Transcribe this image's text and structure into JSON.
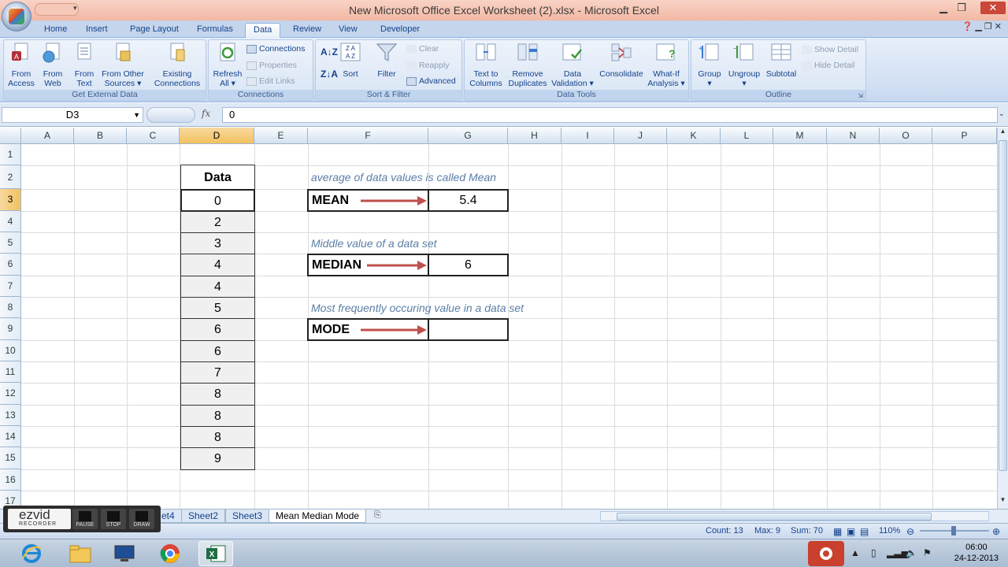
{
  "window": {
    "title": "New Microsoft Office Excel Worksheet (2).xlsx - Microsoft Excel"
  },
  "tabs": [
    "Home",
    "Insert",
    "Page Layout",
    "Formulas",
    "Data",
    "Review",
    "View",
    "Developer"
  ],
  "active_tab": "Data",
  "ribbon": {
    "get_external_data": {
      "label": "Get External Data",
      "from_access": [
        "From",
        "Access"
      ],
      "from_web": [
        "From",
        "Web"
      ],
      "from_text": [
        "From",
        "Text"
      ],
      "from_other": [
        "From Other",
        "Sources ▾"
      ],
      "existing": [
        "Existing",
        "Connections"
      ]
    },
    "connections": {
      "label": "Connections",
      "refresh": [
        "Refresh",
        "All ▾"
      ],
      "connections": "Connections",
      "properties": "Properties",
      "edit_links": "Edit Links"
    },
    "sort_filter": {
      "label": "Sort & Filter",
      "sort": "Sort",
      "filter": "Filter",
      "clear": "Clear",
      "reapply": "Reapply",
      "advanced": "Advanced"
    },
    "data_tools": {
      "label": "Data Tools",
      "text_to_columns": [
        "Text to",
        "Columns"
      ],
      "remove_duplicates": [
        "Remove",
        "Duplicates"
      ],
      "data_validation": [
        "Data",
        "Validation ▾"
      ],
      "consolidate": "Consolidate",
      "what_if": [
        "What-If",
        "Analysis ▾"
      ]
    },
    "outline": {
      "label": "Outline",
      "group": [
        "Group",
        "▾"
      ],
      "ungroup": [
        "Ungroup",
        "▾"
      ],
      "subtotal": "Subtotal",
      "show_detail": "Show Detail",
      "hide_detail": "Hide Detail"
    }
  },
  "formula_bar": {
    "name_box": "D3",
    "fx": "fx",
    "value": "0"
  },
  "columns": [
    "A",
    "B",
    "C",
    "D",
    "E",
    "F",
    "G",
    "H",
    "I",
    "J",
    "K",
    "L",
    "M",
    "N",
    "O",
    "P"
  ],
  "rows": [
    "1",
    "2",
    "3",
    "4",
    "5",
    "6",
    "7",
    "8",
    "9",
    "10",
    "11",
    "12",
    "13",
    "14",
    "15",
    "16",
    "17"
  ],
  "selected_column": "D",
  "selected_row": "3",
  "sheet": {
    "data_header": "Data",
    "data_values": [
      "0",
      "2",
      "3",
      "4",
      "4",
      "5",
      "6",
      "6",
      "7",
      "8",
      "8",
      "8",
      "9"
    ],
    "mean_note": "average of data values is called Mean",
    "mean_label": "MEAN",
    "mean_value": "5.4",
    "median_note": "Middle value of a data set",
    "median_label": "MEDIAN",
    "median_value": "6",
    "mode_note": "Most frequently occuring value in a data set",
    "mode_label": "MODE",
    "mode_value": ""
  },
  "sheet_tabs": [
    "et4",
    "Sheet2",
    "Sheet3",
    "Mean Median Mode"
  ],
  "active_sheet": "Mean Median Mode",
  "recorder": {
    "brand": "ezvid",
    "sub": "RECORDER",
    "pause": "PAUSE",
    "stop": "STOP",
    "draw": "DRAW"
  },
  "status": {
    "count": "Count: 13",
    "max": "Max: 9",
    "sum": "Sum: 70",
    "zoom": "110%"
  },
  "taskbar": {
    "time": "06:00",
    "date": "24-12-2013"
  },
  "colors": {
    "accent": "#15428b",
    "arrow": "#c0504d",
    "note": "#5b7ea6"
  }
}
